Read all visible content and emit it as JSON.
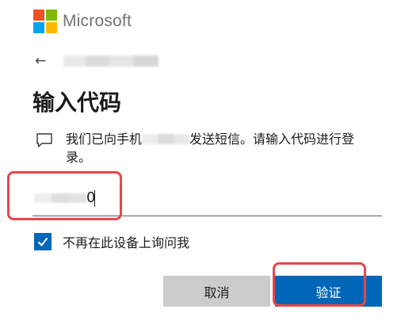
{
  "brand": {
    "name": "Microsoft",
    "colors": [
      "#f25022",
      "#7fba00",
      "#00a4ef",
      "#ffb900"
    ]
  },
  "nav": {
    "back_icon": "←"
  },
  "page": {
    "title": "输入代码"
  },
  "message": {
    "icon": "chat-bubble-icon",
    "text_before": "我们已向手机",
    "text_after": "发送短信。请输入代码进行登录。"
  },
  "code_input": {
    "visible_value": "0"
  },
  "remember": {
    "checked": true,
    "label": "不再在此设备上询问我"
  },
  "buttons": {
    "cancel": "取消",
    "verify": "验证"
  },
  "accent": {
    "primary": "#0067b8",
    "highlight": "#e8464a"
  }
}
